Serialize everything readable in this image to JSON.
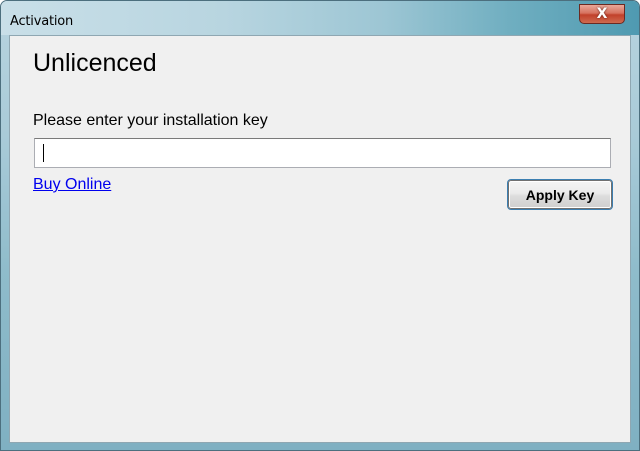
{
  "window": {
    "title": "Activation",
    "close_glyph": "X",
    "close_icon": "close-icon"
  },
  "main": {
    "heading": "Unlicenced",
    "prompt": "Please enter your installation key",
    "key_input": {
      "value": "",
      "placeholder": ""
    },
    "buy_link": "Buy Online",
    "apply_button": "Apply Key"
  },
  "colors": {
    "link": "#0000ee",
    "client_background": "#f0f0f0",
    "close_button": "#c1412b"
  }
}
